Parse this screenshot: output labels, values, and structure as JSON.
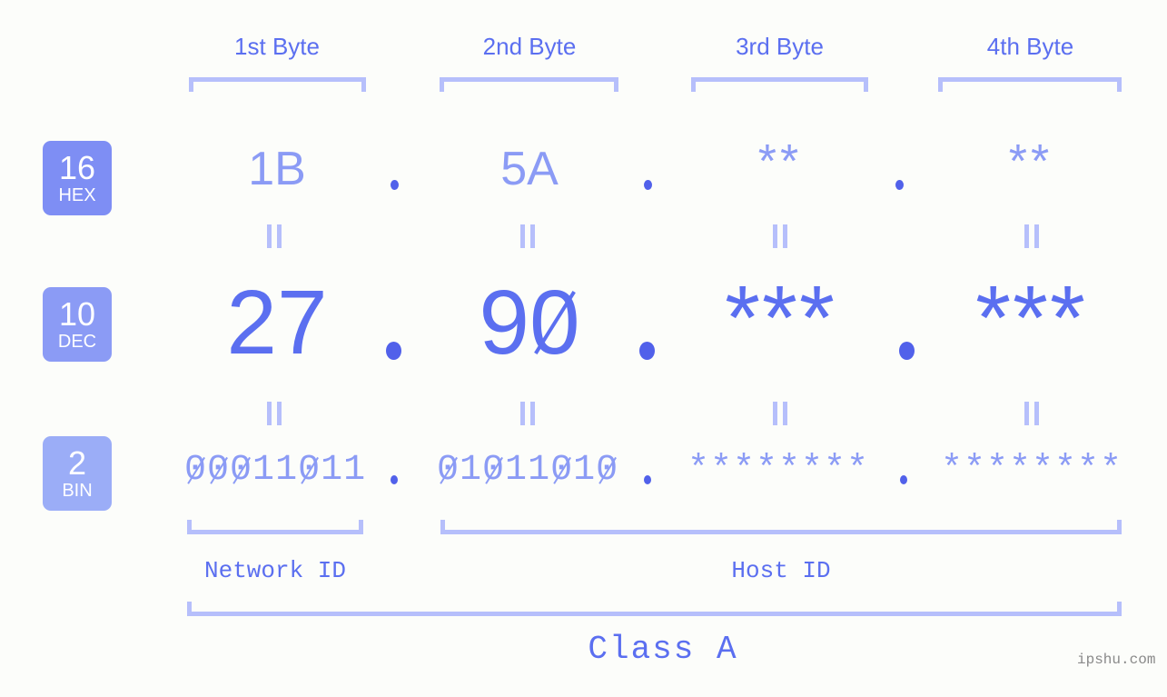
{
  "colors": {
    "background": "#fcfdfa",
    "accent_strong": "#5b6ff0",
    "accent_mid": "#8b9bf5",
    "accent_light": "#b6bffb",
    "dot": "#5161ea",
    "badge_hex": "#7e8ef4",
    "badge_dec": "#8b9bf5",
    "badge_bin": "#9badf7",
    "watermark": "#8a8a8a"
  },
  "byte_headers": [
    {
      "label": "1st Byte"
    },
    {
      "label": "2nd Byte"
    },
    {
      "label": "3rd Byte"
    },
    {
      "label": "4th Byte"
    }
  ],
  "bases": [
    {
      "number": "16",
      "abbr": "HEX"
    },
    {
      "number": "10",
      "abbr": "DEC"
    },
    {
      "number": "2",
      "abbr": "BIN"
    }
  ],
  "rows": {
    "hex": {
      "values": [
        "1B",
        "5A",
        "**",
        "**"
      ]
    },
    "dec": {
      "values": [
        "27",
        "90",
        "***",
        "***"
      ]
    },
    "bin": {
      "values": [
        "00011011",
        "01011010",
        "********",
        "********"
      ]
    }
  },
  "separators": {
    "dot": "."
  },
  "equals_marks": {
    "symbol": "||"
  },
  "sections": [
    {
      "label": "Network ID"
    },
    {
      "label": "Host ID"
    }
  ],
  "class": {
    "label": "Class A"
  },
  "watermark": {
    "text": "ipshu.com"
  }
}
